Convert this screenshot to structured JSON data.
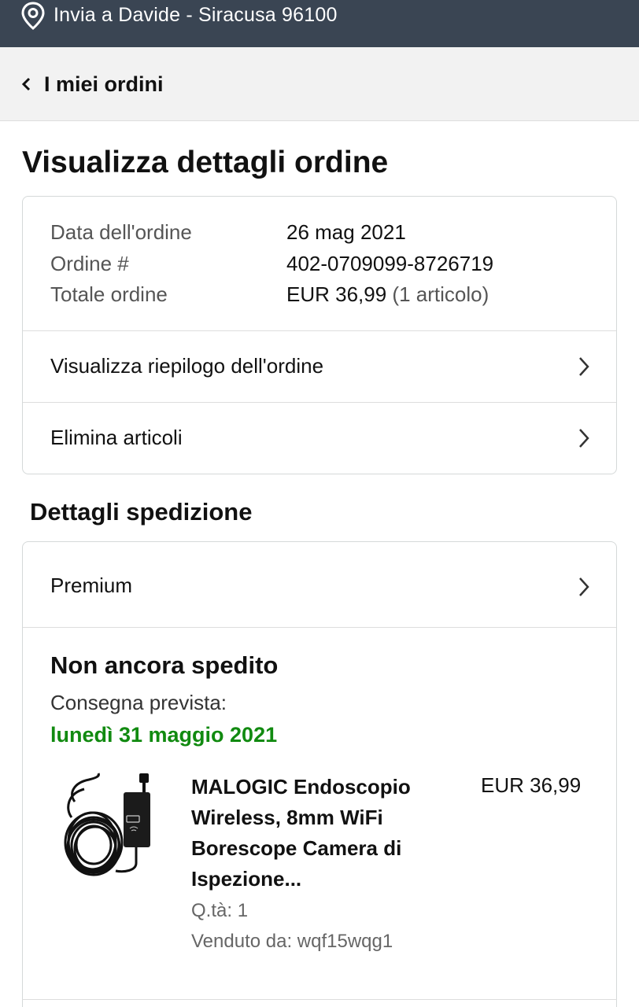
{
  "header": {
    "delivery_address": "Invia a Davide - Siracusa 96100",
    "icon": "location-pin-icon"
  },
  "nav": {
    "back_label": "I miei ordini",
    "icon": "chevron-left-icon"
  },
  "page": {
    "title": "Visualizza dettagli ordine"
  },
  "order": {
    "rows": [
      {
        "label": "Data dell'ordine",
        "value": "26 mag 2021"
      },
      {
        "label": "Ordine #",
        "value": "402-0709099-8726719"
      },
      {
        "label": "Totale ordine",
        "value": "EUR 36,99",
        "extra": "(1 articolo)"
      }
    ],
    "links": [
      {
        "label": "Visualizza riepilogo dell'ordine"
      },
      {
        "label": "Elimina articoli"
      }
    ]
  },
  "shipping": {
    "section_title": "Dettagli spedizione",
    "method": "Premium",
    "status": "Non ancora spedito",
    "eta_label": "Consegna prevista:",
    "eta_date": "lunedì 31 maggio 2021",
    "item": {
      "title": "MALOGIC Endoscopio Wireless, 8mm WiFi Borescope Camera di Ispezione...",
      "price": "EUR 36,99",
      "quantity": "Q.tà: 1",
      "seller": "Venduto da: wqf15wqg1",
      "image": "endoscope-camera-product-image"
    }
  },
  "colors": {
    "header_bg": "#3a4553",
    "eta_green": "#118a10",
    "backbar_bg": "#f2f2f2"
  }
}
